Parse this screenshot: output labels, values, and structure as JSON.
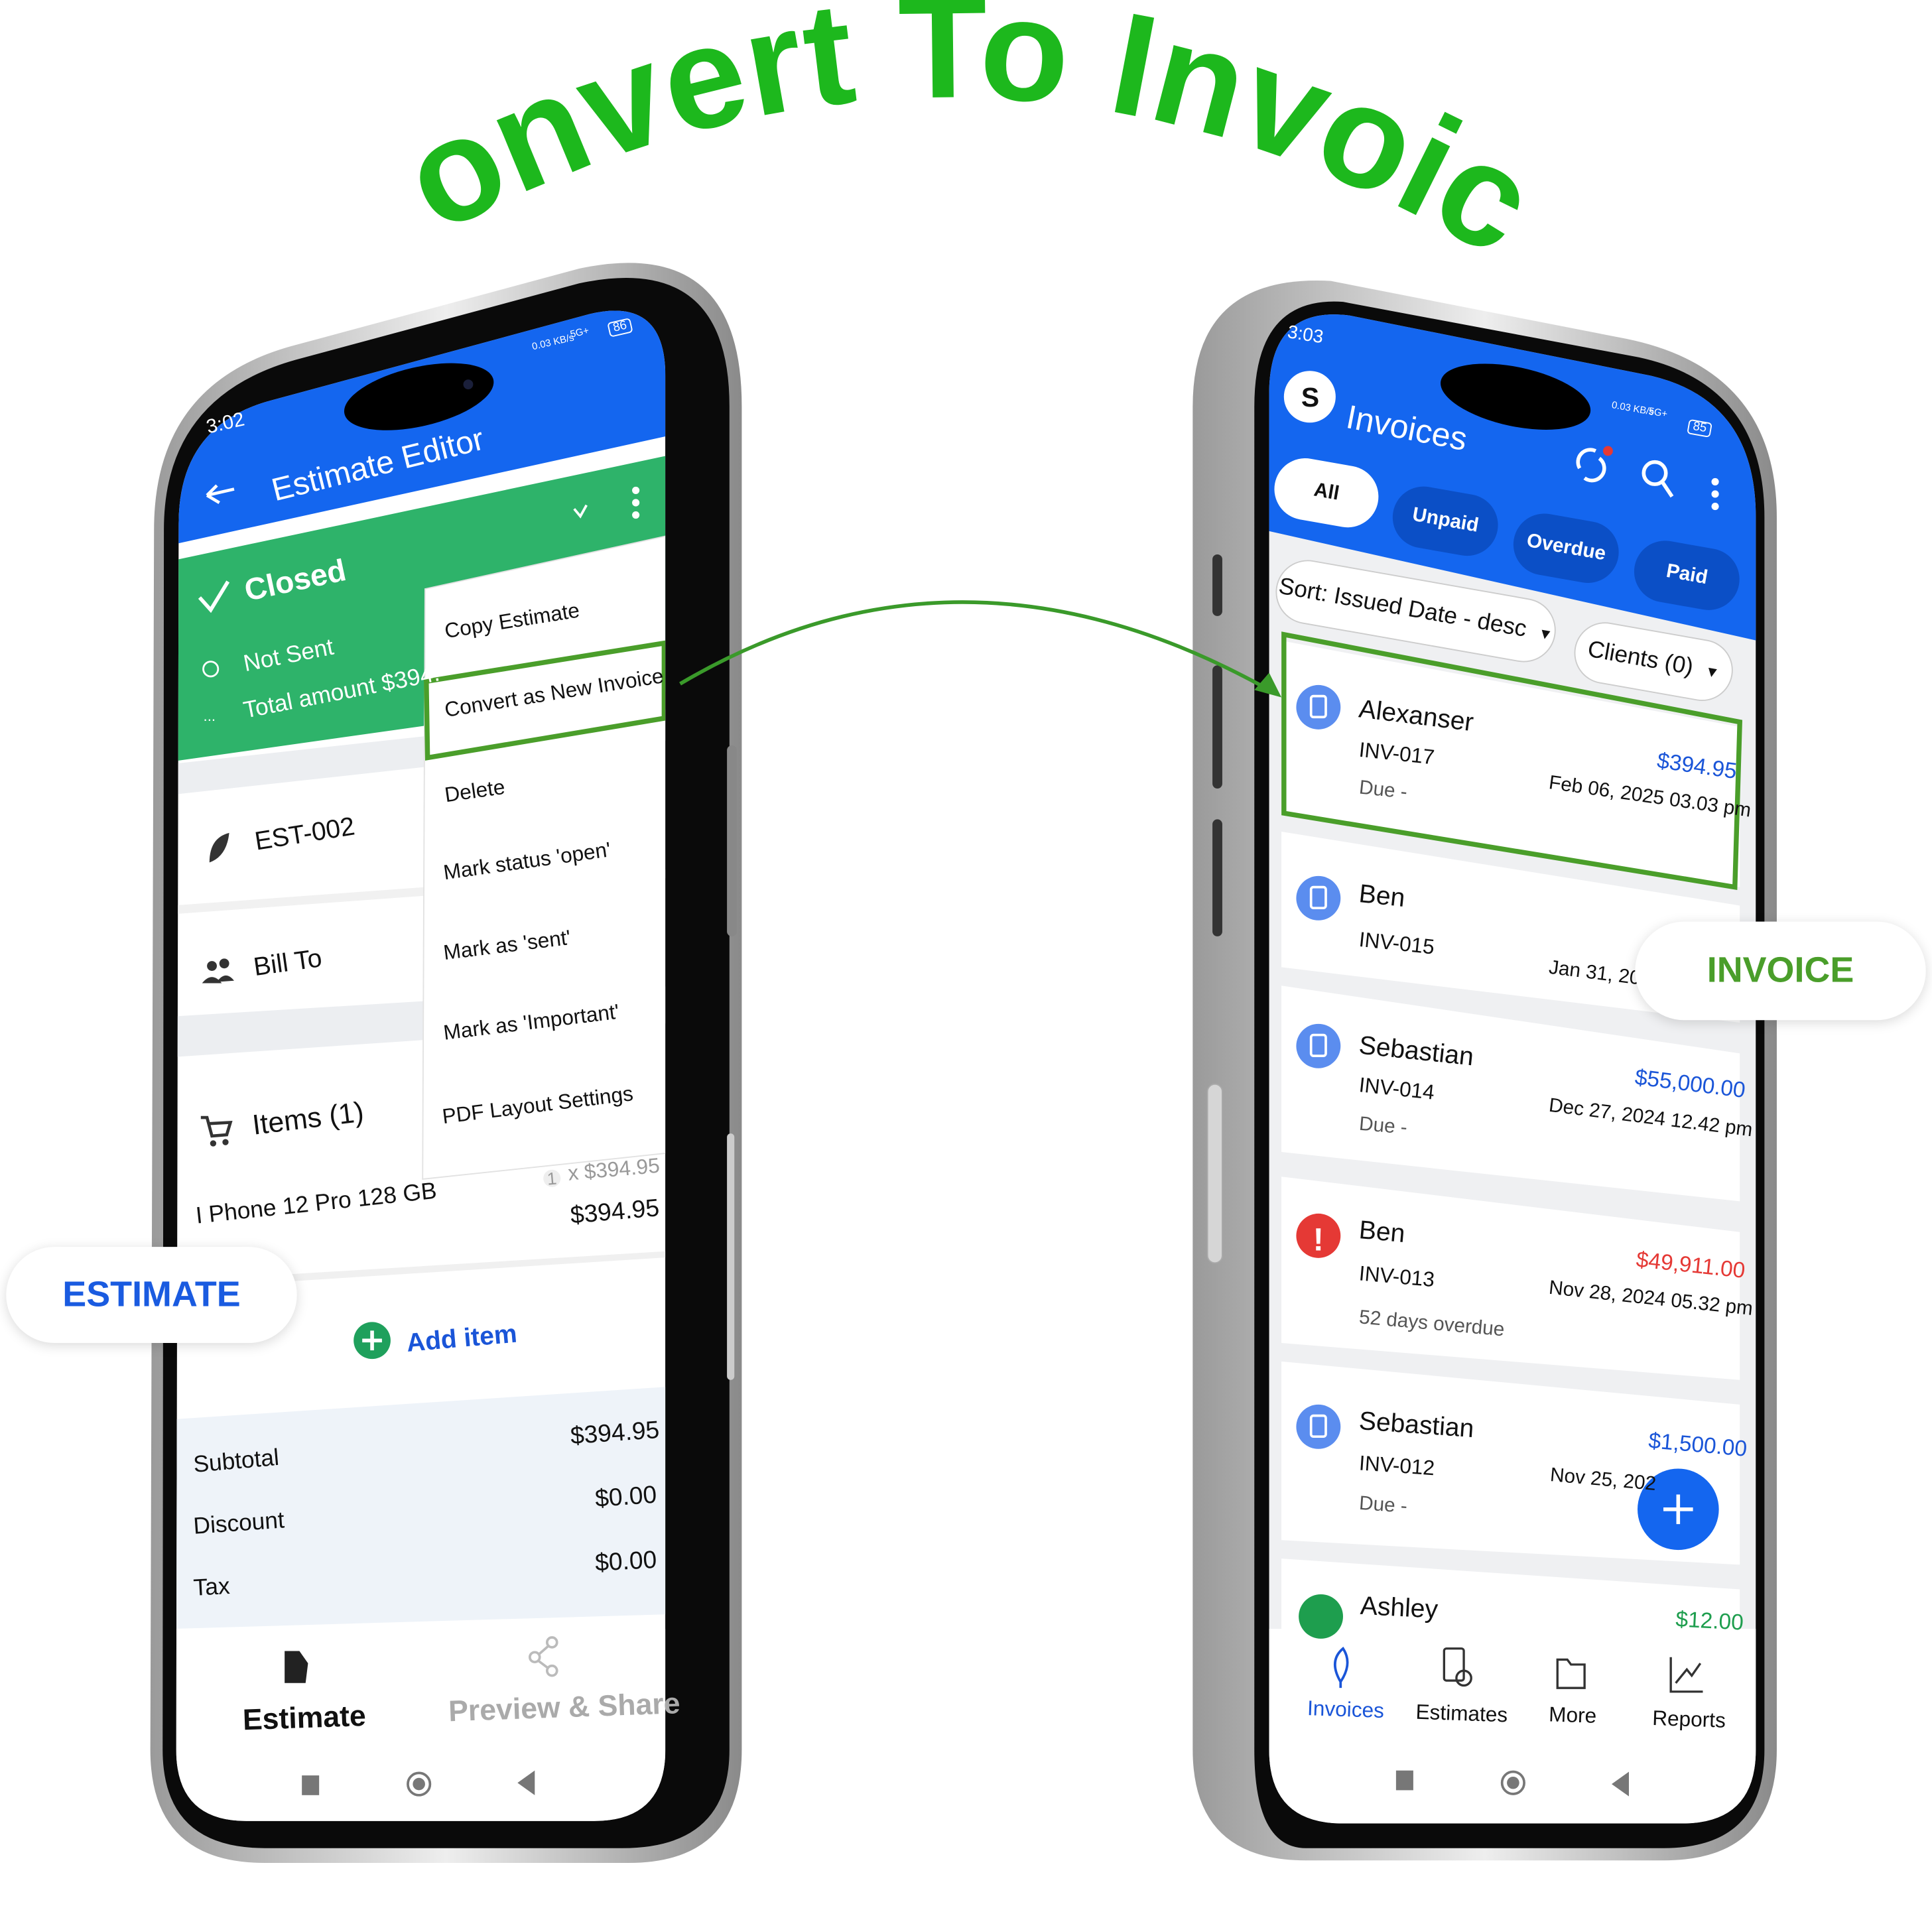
{
  "headline": "Convert To Invoice",
  "colors": {
    "headline": "#1db81d",
    "app_blue": "#1466ef",
    "header_green": "#2eb36a",
    "highlight_green": "#4a9e2a",
    "tab_dark": "#0b4fc6",
    "overdue_red": "#e53935",
    "paid_green": "#1e9e4e"
  },
  "badges": {
    "estimate": "ESTIMATE",
    "invoice": "INVOICE"
  },
  "left_phone": {
    "status": {
      "time": "3:02",
      "net": "0.03 KB/s",
      "signal": "5G+",
      "battery": "86"
    },
    "title": "Estimate Editor",
    "estimate_status": {
      "state": "Closed",
      "sent": "Not Sent",
      "total": "Total amount $394."
    },
    "menu": [
      "Copy Estimate",
      "Convert as New Invoice",
      "Delete",
      "Mark status 'open'",
      "Mark as 'sent'",
      "Mark as 'Important'",
      "PDF Layout Settings"
    ],
    "estimate_number": "EST-002",
    "bill_to": "Bill To",
    "items_label": "Items (1)",
    "item": {
      "name": "I Phone 12 Pro 128 GB",
      "qty": "1",
      "unit": "x $394.95",
      "total": "$394.95"
    },
    "add_item": "Add item",
    "totals": [
      {
        "label": "Subtotal",
        "value": "$394.95"
      },
      {
        "label": "Discount",
        "value": "$0.00"
      },
      {
        "label": "Tax",
        "value": "$0.00"
      }
    ],
    "bottom_nav": [
      {
        "label": "Estimate",
        "icon": "document-icon",
        "active": true
      },
      {
        "label": "Preview & Share",
        "icon": "share-icon",
        "active": false
      }
    ]
  },
  "right_phone": {
    "status": {
      "time": "3:03",
      "net": "0.03 KB/s",
      "signal": "5G+",
      "battery": "85"
    },
    "avatar": "S",
    "title": "Invoices",
    "tabs": [
      {
        "label": "All",
        "active": true
      },
      {
        "label": "Unpaid",
        "active": false
      },
      {
        "label": "Overdue",
        "active": false
      },
      {
        "label": "Paid",
        "active": false
      }
    ],
    "sort": "Sort: Issued Date - desc",
    "clients": "Clients (0)",
    "invoices": [
      {
        "client": "Alexanser",
        "number": "INV-017",
        "status": "Due -",
        "amount": "$394.95",
        "date": "Feb 06, 2025 03.03 pm",
        "kind": "due",
        "highlighted": true
      },
      {
        "client": "Ben",
        "number": "INV-015",
        "status": "",
        "amount": "",
        "date": "Jan 31, 202",
        "kind": "due"
      },
      {
        "client": "Sebastian",
        "number": "INV-014",
        "status": "Due -",
        "amount": "$55,000.00",
        "date": "Dec 27, 2024 12.42 pm",
        "kind": "due"
      },
      {
        "client": "Ben",
        "number": "INV-013",
        "status": "52 days overdue",
        "amount": "$49,911.00",
        "date": "Nov 28, 2024 05.32 pm",
        "kind": "overdue"
      },
      {
        "client": "Sebastian",
        "number": "INV-012",
        "status": "Due -",
        "amount": "$1,500.00",
        "date": "Nov 25, 202",
        "kind": "due"
      },
      {
        "client": "Ashley",
        "number": "",
        "status": "",
        "amount": "$12.00",
        "date": "",
        "kind": "paid"
      }
    ],
    "bottom_nav": [
      {
        "label": "Invoices",
        "icon": "leaf-icon",
        "active": true
      },
      {
        "label": "Estimates",
        "icon": "calculator-icon",
        "active": false
      },
      {
        "label": "More",
        "icon": "folder-icon",
        "active": false
      },
      {
        "label": "Reports",
        "icon": "chart-icon",
        "active": false
      }
    ]
  }
}
